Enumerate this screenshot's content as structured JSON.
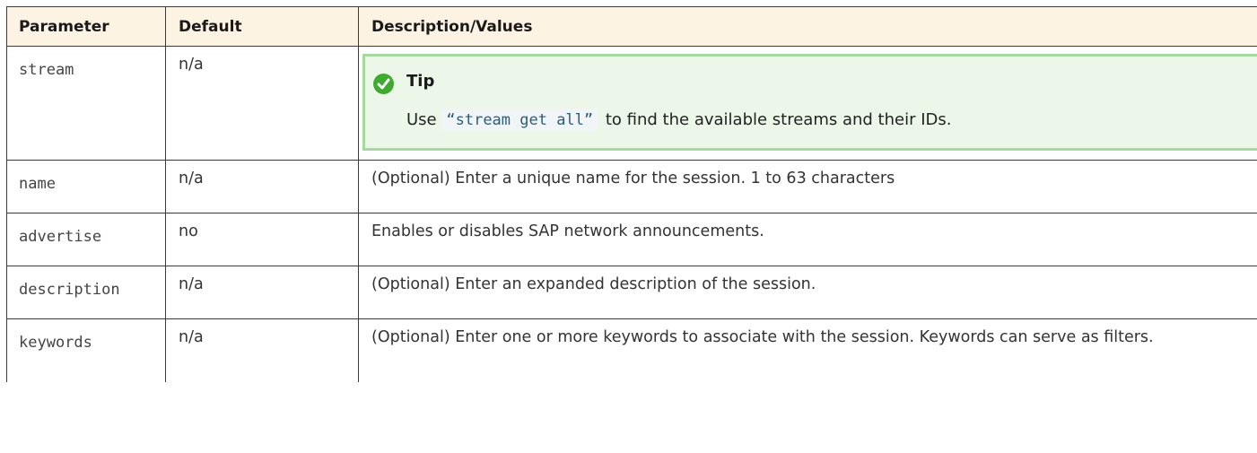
{
  "table": {
    "headers": {
      "parameter": "Parameter",
      "default": "Default",
      "description": "Description/Values"
    },
    "rows": [
      {
        "parameter": "stream",
        "default": "n/a",
        "tip": {
          "icon": "check-circle-icon",
          "title": "Tip",
          "text_before": "Use",
          "code": "“stream get all”",
          "text_after": "to find the available streams and their IDs."
        }
      },
      {
        "parameter": "name",
        "default": "n/a",
        "description": "(Optional) Enter a unique name for the session. 1 to 63 characters"
      },
      {
        "parameter": "advertise",
        "default": "no",
        "description": "Enables or disables SAP network announcements."
      },
      {
        "parameter": "description",
        "default": "n/a",
        "description": "(Optional) Enter an expanded description of the session."
      },
      {
        "parameter": "keywords",
        "default": "n/a",
        "description": "(Optional) Enter one or more keywords to associate with the session. Keywords can serve as filters."
      }
    ]
  },
  "colors": {
    "header_bg": "#fdf3e3",
    "tip_bg": "#ecf7ea",
    "tip_border": "#a6d9a0",
    "tip_icon": "#3eaa2f"
  }
}
